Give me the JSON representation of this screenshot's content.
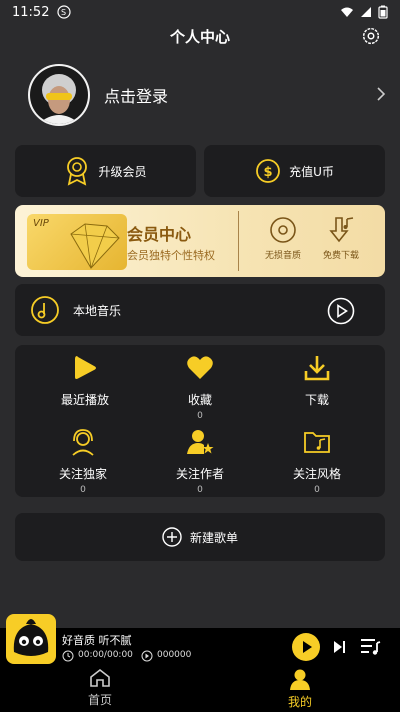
{
  "status_bar": {
    "time": "11:52"
  },
  "header": {
    "title": "个人中心"
  },
  "profile": {
    "login_text": "点击登录"
  },
  "buttons": {
    "upgrade_label": "升级会员",
    "recharge_label": "充值U币"
  },
  "vip": {
    "tag": "VIP",
    "title": "会员中心",
    "subtitle": "会员独特个性特权",
    "features": [
      {
        "label": "无损音质"
      },
      {
        "label": "免费下载"
      }
    ]
  },
  "local_music": {
    "label": "本地音乐"
  },
  "grid": [
    {
      "label": "最近播放",
      "count": ""
    },
    {
      "label": "收藏",
      "count": "0"
    },
    {
      "label": "下载",
      "count": ""
    },
    {
      "label": "关注独家",
      "count": "0"
    },
    {
      "label": "关注作者",
      "count": "0"
    },
    {
      "label": "关注风格",
      "count": "0"
    }
  ],
  "new_playlist": {
    "label": "新建歌单"
  },
  "player": {
    "song": "好音质 听不腻",
    "time": "00:00/00:00",
    "plays": "000000"
  },
  "nav": {
    "home": "首页",
    "mine": "我的"
  },
  "colors": {
    "accent": "#f7cd26",
    "card": "#1d1d1f",
    "background": "#2b2b2d"
  }
}
